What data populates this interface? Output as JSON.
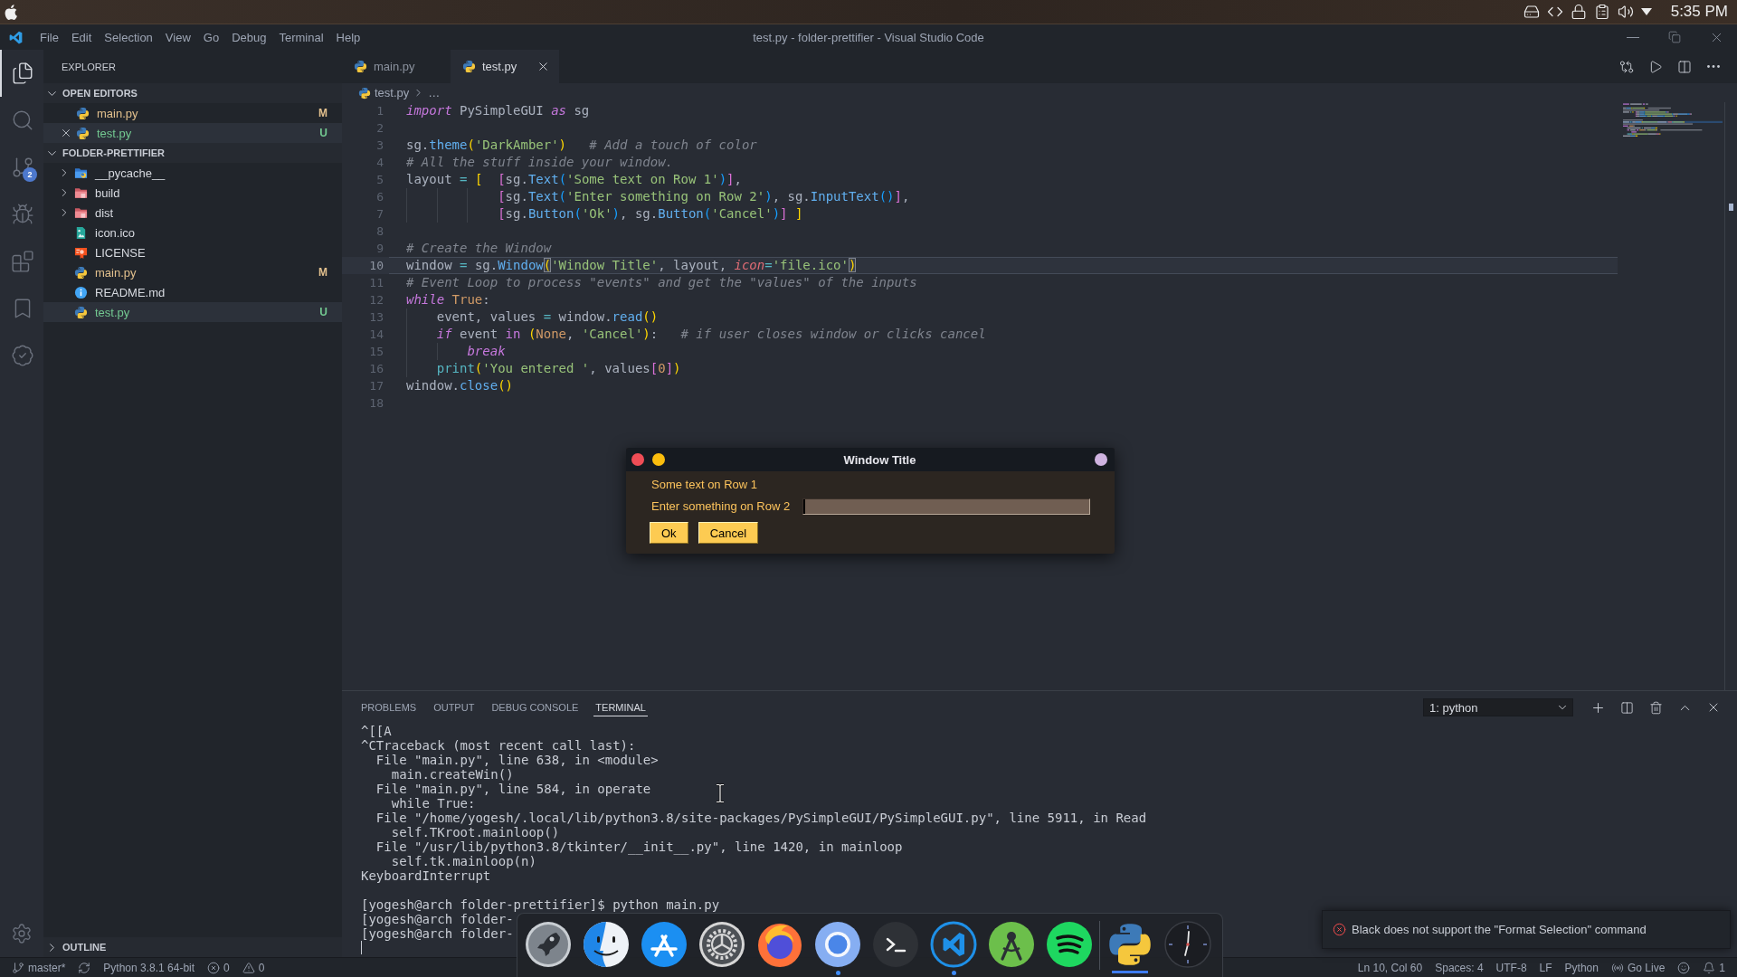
{
  "system_bar": {
    "tray": [
      {
        "kind": "drive"
      },
      {
        "kind": "remote"
      },
      {
        "kind": "lock"
      },
      {
        "kind": "clipboard"
      },
      {
        "kind": "volume"
      },
      {
        "kind": "menu"
      }
    ],
    "clock": "5:35 PM"
  },
  "title_bar": {
    "menu": [
      "File",
      "Edit",
      "Selection",
      "View",
      "Go",
      "Debug",
      "Terminal",
      "Help"
    ],
    "title": "test.py - folder-prettifier - Visual Studio Code"
  },
  "activity_bar": {
    "items": [
      {
        "kind": "explorer",
        "selected": true
      },
      {
        "kind": "search",
        "selected": false
      },
      {
        "kind": "source-control",
        "selected": false,
        "badge": "2"
      },
      {
        "kind": "debug",
        "selected": false
      },
      {
        "kind": "extensions",
        "selected": false
      },
      {
        "kind": "bookmarks",
        "selected": false
      },
      {
        "kind": "check",
        "selected": false
      }
    ]
  },
  "sidebar": {
    "title": "EXPLORER",
    "sections": [
      {
        "title": "OPEN EDITORS",
        "expanded": true,
        "items": [
          {
            "name": "main.py",
            "kind": "python",
            "color": "#e2c08d",
            "badge": "M",
            "selected": false
          },
          {
            "name": "test.py",
            "kind": "python",
            "color": "#73c991",
            "badge": "U",
            "selected": true
          }
        ]
      },
      {
        "title": "FOLDER-PRETTIFIER",
        "expanded": true,
        "items": [
          {
            "name": "__pycache__",
            "kind": "python-folder",
            "expanded": false,
            "selected": false
          },
          {
            "name": "build",
            "kind": "folder",
            "expanded": false,
            "selected": false
          },
          {
            "name": "dist",
            "kind": "folder",
            "expanded": false,
            "selected": false
          },
          {
            "name": "icon.ico",
            "kind": "image",
            "selected": false
          },
          {
            "name": "LICENSE",
            "kind": "license",
            "selected": false
          },
          {
            "name": "main.py",
            "kind": "python",
            "color": "#e2c08d",
            "badge": "M",
            "selected": false
          },
          {
            "name": "README.md",
            "kind": "readme",
            "selected": false
          },
          {
            "name": "test.py",
            "kind": "python",
            "color": "#73c991",
            "badge": "U",
            "selected": true
          }
        ]
      }
    ],
    "outline": {
      "title": "OUTLINE",
      "expanded": false
    }
  },
  "editor": {
    "tabs": [
      {
        "label": "main.py",
        "kind": "python",
        "selected": false
      },
      {
        "label": "test.py",
        "kind": "python",
        "selected": true
      }
    ],
    "breadcrumb": [
      "test.py",
      "…"
    ],
    "lines": [
      {
        "number": "1",
        "active": false,
        "tokens": [
          {
            "kind": "keyword",
            "text": "import"
          },
          {
            "kind": "plain",
            "text": " PySimpleGUI "
          },
          {
            "kind": "keyword",
            "text": "as"
          },
          {
            "kind": "plain",
            "text": " sg"
          }
        ]
      },
      {
        "number": "2",
        "active": false
      },
      {
        "number": "3",
        "active": false,
        "tokens": [
          {
            "kind": "plain",
            "text": "sg."
          },
          {
            "kind": "function",
            "text": "theme"
          },
          {
            "kind": "bracket1",
            "text": "("
          },
          {
            "kind": "string",
            "text": "'DarkAmber'"
          },
          {
            "kind": "bracket1",
            "text": ")"
          },
          {
            "kind": "comment",
            "text": "   # Add a touch of color"
          }
        ]
      },
      {
        "number": "4",
        "active": false,
        "tokens": [
          {
            "kind": "comment",
            "text": "# All the stuff inside your window."
          }
        ]
      },
      {
        "number": "5",
        "active": false,
        "tokens": [
          {
            "kind": "plain",
            "text": "layout "
          },
          {
            "kind": "operator",
            "text": "="
          },
          {
            "kind": "bracket1",
            "text": " ["
          },
          {
            "kind": "bracket2",
            "text": "  ["
          },
          {
            "kind": "plain",
            "text": "sg."
          },
          {
            "kind": "function",
            "text": "Text"
          },
          {
            "kind": "bracket3",
            "text": "("
          },
          {
            "kind": "string",
            "text": "'Some text on Row 1'"
          },
          {
            "kind": "bracket3",
            "text": ")"
          },
          {
            "kind": "bracket2",
            "text": "]"
          },
          {
            "kind": "plain",
            "text": ","
          }
        ]
      },
      {
        "number": "6",
        "active": false,
        "tokens": [
          {
            "kind": "bracket2",
            "text": "            ["
          },
          {
            "kind": "plain",
            "text": "sg."
          },
          {
            "kind": "function",
            "text": "Text"
          },
          {
            "kind": "bracket3",
            "text": "("
          },
          {
            "kind": "string",
            "text": "'Enter something on Row 2'"
          },
          {
            "kind": "bracket3",
            "text": ")"
          },
          {
            "kind": "plain",
            "text": ", sg."
          },
          {
            "kind": "function",
            "text": "InputText"
          },
          {
            "kind": "bracket3",
            "text": "()"
          },
          {
            "kind": "bracket2",
            "text": "]"
          },
          {
            "kind": "plain",
            "text": ","
          }
        ]
      },
      {
        "number": "7",
        "active": false,
        "tokens": [
          {
            "kind": "bracket2",
            "text": "            ["
          },
          {
            "kind": "plain",
            "text": "sg."
          },
          {
            "kind": "function",
            "text": "Button"
          },
          {
            "kind": "bracket3",
            "text": "("
          },
          {
            "kind": "string",
            "text": "'Ok'"
          },
          {
            "kind": "bracket3",
            "text": ")"
          },
          {
            "kind": "plain",
            "text": ", sg."
          },
          {
            "kind": "function",
            "text": "Button"
          },
          {
            "kind": "bracket3",
            "text": "("
          },
          {
            "kind": "string",
            "text": "'Cancel'"
          },
          {
            "kind": "bracket3",
            "text": ")"
          },
          {
            "kind": "bracket2",
            "text": "]"
          },
          {
            "kind": "bracket1",
            "text": " ]"
          }
        ]
      },
      {
        "number": "8",
        "active": false
      },
      {
        "number": "9",
        "active": false,
        "tokens": [
          {
            "kind": "comment",
            "text": "# Create the Window"
          }
        ]
      },
      {
        "number": "10",
        "active": true,
        "tokens": [
          {
            "kind": "plain",
            "text": "window "
          },
          {
            "kind": "operator",
            "text": "="
          },
          {
            "kind": "plain",
            "text": " sg."
          },
          {
            "kind": "function",
            "text": "Window"
          },
          {
            "kind": "match",
            "text": "("
          },
          {
            "kind": "string",
            "text": "'Window Title'"
          },
          {
            "kind": "plain",
            "text": ", layout, "
          },
          {
            "kind": "param",
            "text": "icon"
          },
          {
            "kind": "operator",
            "text": "="
          },
          {
            "kind": "string",
            "text": "'file.ico'"
          },
          {
            "kind": "match",
            "text": ")"
          }
        ]
      },
      {
        "number": "11",
        "active": false,
        "tokens": [
          {
            "kind": "comment",
            "text": "# Event Loop to process \"events\" and get the \"values\" of the inputs"
          }
        ]
      },
      {
        "number": "12",
        "active": false,
        "tokens": [
          {
            "kind": "keyword",
            "text": "while"
          },
          {
            "kind": "constant",
            "text": " True"
          },
          {
            "kind": "plain",
            "text": ":"
          }
        ]
      },
      {
        "number": "13",
        "active": false,
        "tokens": [
          {
            "kind": "plain",
            "text": "    event, values "
          },
          {
            "kind": "operator",
            "text": "="
          },
          {
            "kind": "plain",
            "text": " window."
          },
          {
            "kind": "function",
            "text": "read"
          },
          {
            "kind": "bracket1",
            "text": "()"
          }
        ]
      },
      {
        "number": "14",
        "active": false,
        "tokens": [
          {
            "kind": "keyword",
            "text": "    if"
          },
          {
            "kind": "plain",
            "text": " event "
          },
          {
            "kind": "keyword2",
            "text": "in"
          },
          {
            "kind": "bracket1",
            "text": " ("
          },
          {
            "kind": "constant",
            "text": "None"
          },
          {
            "kind": "plain",
            "text": ", "
          },
          {
            "kind": "string",
            "text": "'Cancel'"
          },
          {
            "kind": "bracket1",
            "text": ")"
          },
          {
            "kind": "plain",
            "text": ":"
          },
          {
            "kind": "comment",
            "text": "   # if user closes window or clicks cancel"
          }
        ]
      },
      {
        "number": "15",
        "active": false,
        "tokens": [
          {
            "kind": "keyword",
            "text": "        break"
          }
        ]
      },
      {
        "number": "16",
        "active": false,
        "tokens": [
          {
            "kind": "builtin",
            "text": "    print"
          },
          {
            "kind": "bracket1",
            "text": "("
          },
          {
            "kind": "string",
            "text": "'You entered '"
          },
          {
            "kind": "plain",
            "text": ", values"
          },
          {
            "kind": "bracket2",
            "text": "["
          },
          {
            "kind": "constant",
            "text": "0"
          },
          {
            "kind": "bracket2",
            "text": "]"
          },
          {
            "kind": "bracket1",
            "text": ")"
          }
        ]
      },
      {
        "number": "17",
        "active": false,
        "tokens": [
          {
            "kind": "plain",
            "text": "window."
          },
          {
            "kind": "function",
            "text": "close"
          },
          {
            "kind": "bracket1",
            "text": "()"
          }
        ]
      },
      {
        "number": "18",
        "active": false
      }
    ]
  },
  "panel": {
    "tabs": [
      {
        "label": "PROBLEMS",
        "selected": false
      },
      {
        "label": "OUTPUT",
        "selected": false
      },
      {
        "label": "DEBUG CONSOLE",
        "selected": false
      },
      {
        "label": "TERMINAL",
        "selected": true
      }
    ],
    "terminal_select": "1: python",
    "terminal": {
      "blocks": [
        {
          "lines": [
            "^[[A",
            "^CTraceback (most recent call last):",
            "  File \"main.py\", line 638, in <module>",
            "    main.createWin()",
            "  File \"main.py\", line 584, in operate",
            "    while True:",
            "  File \"/home/yogesh/.local/lib/python3.8/site-packages/PySimpleGUI/PySimpleGUI.py\", line 5911, in Read",
            "    self.TKroot.mainloop()",
            "  File \"/usr/lib/python3.8/tkinter/__init__.py\", line 1420, in mainloop",
            "    self.tk.mainloop(n)",
            "KeyboardInterrupt"
          ]
        },
        {
          "lines": [
            "[yogesh@arch folder-prettifier]$ python main.py",
            "[yogesh@arch folder-",
            "[yogesh@arch folder-"
          ]
        }
      ]
    }
  },
  "status_bar": {
    "left": [
      {
        "kind": "branch",
        "text": "master*"
      },
      {
        "kind": "sync"
      },
      {
        "kind": "interpreter",
        "text": "Python 3.8.1 64-bit"
      },
      {
        "kind": "errors",
        "text": "0"
      },
      {
        "kind": "warnings",
        "text": "0"
      }
    ],
    "right": [
      {
        "kind": "position",
        "text": "Ln 10, Col 60"
      },
      {
        "kind": "indentation",
        "text": "Spaces: 4"
      },
      {
        "kind": "encoding",
        "text": "UTF-8"
      },
      {
        "kind": "eol",
        "text": "LF"
      },
      {
        "kind": "language",
        "text": "Python"
      },
      {
        "kind": "live",
        "text": "Go Live"
      },
      {
        "kind": "feedback"
      },
      {
        "kind": "notifications",
        "text": "1"
      }
    ]
  },
  "dialog": {
    "title": "Window Title",
    "text": "Some text on Row 1",
    "input_label": "Enter something on Row 2",
    "buttons": [
      "Ok",
      "Cancel"
    ]
  },
  "dock": {
    "items": [
      {
        "kind": "rocket",
        "running": false,
        "selected": false
      },
      {
        "kind": "finder",
        "running": false,
        "selected": false
      },
      {
        "kind": "app-store",
        "running": false,
        "selected": false
      },
      {
        "kind": "settings",
        "running": false,
        "selected": false
      },
      {
        "kind": "firefox",
        "running": false,
        "selected": false
      },
      {
        "kind": "chromium",
        "running": true,
        "selected": false
      },
      {
        "kind": "terminal",
        "running": false,
        "selected": false
      },
      {
        "kind": "vscode",
        "running": true,
        "selected": false
      },
      {
        "kind": "android-studio",
        "running": false,
        "selected": false
      },
      {
        "kind": "spotify",
        "running": false,
        "selected": false
      },
      {
        "kind": "separator"
      },
      {
        "kind": "python",
        "running": false,
        "selected": true
      },
      {
        "kind": "clock",
        "running": false,
        "selected": false
      }
    ]
  },
  "notification": {
    "kind": "error",
    "message": "Black does not support the \"Format Selection\" command"
  }
}
